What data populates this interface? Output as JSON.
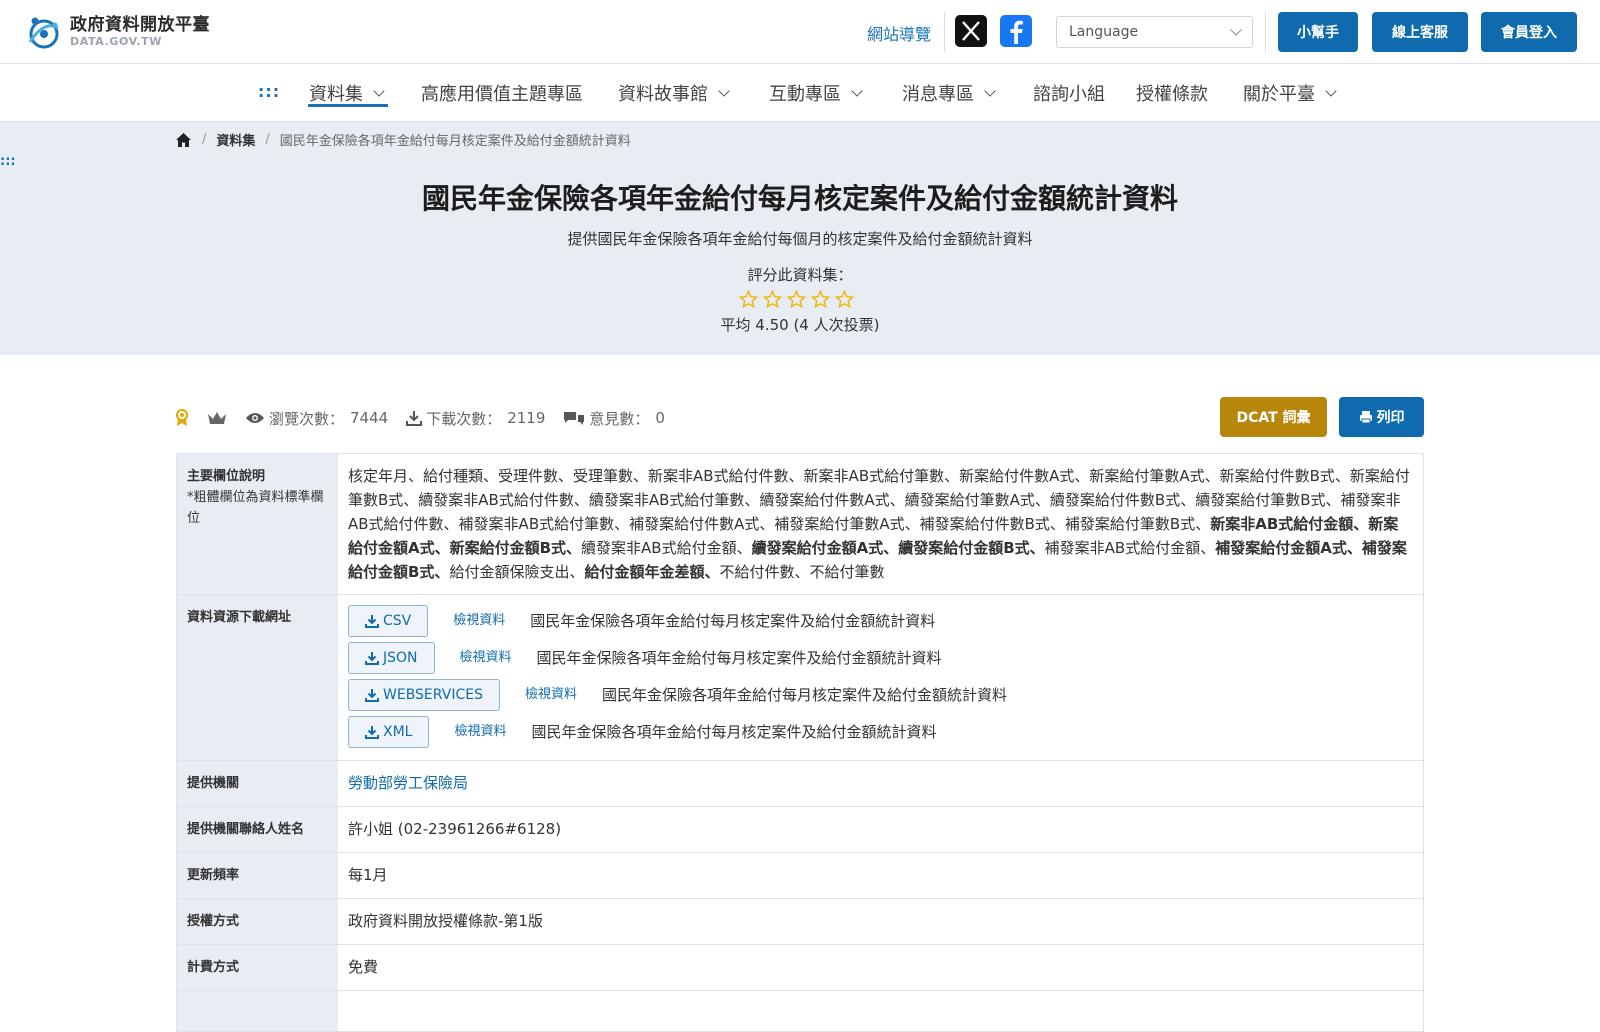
{
  "header": {
    "logo_zh": "政府資料開放平臺",
    "logo_en": "DATA.GOV.TW",
    "sitemap_link": "網站導覽",
    "language_placeholder": "Language",
    "helper_button": "小幫手",
    "support_button": "線上客服",
    "login_button": "會員登入"
  },
  "nav": {
    "accesskey": ":::",
    "items": [
      {
        "label": "資料集"
      },
      {
        "label": "高應用價值主題專區"
      },
      {
        "label": "資料故事館"
      },
      {
        "label": "互動專區"
      },
      {
        "label": "消息專區"
      },
      {
        "label": "諮詢小組"
      },
      {
        "label": "授權條款"
      },
      {
        "label": "關於平臺"
      }
    ]
  },
  "breadcrumb": {
    "items": [
      "資料集",
      "國民年金保險各項年金給付每月核定案件及給付金額統計資料"
    ],
    "separator": "/"
  },
  "hero": {
    "accesskey": ":::",
    "title": "國民年金保險各項年金給付每月核定案件及給付金額統計資料",
    "description": "提供國民年金保險各項年金給付每個月的核定案件及給付金額統計資料",
    "rating_label": "評分此資料集：",
    "average": "平均 4.50 (4 人次投票)",
    "star_color": "#f0b400"
  },
  "stats": {
    "views_label": "瀏覽次數：",
    "views": "7444",
    "downloads_label": "下載次數：",
    "downloads": "2119",
    "comments_label": "意見數：",
    "comments": "0",
    "dcat_button": "DCAT 詞彙",
    "print_button": "列印"
  },
  "table": {
    "fields_label": "主要欄位說明",
    "fields_note": "*粗體欄位為資料標準欄位",
    "fields": [
      {
        "t": "核定年月、給付種類、受理件數、受理筆數、新案非AB式給付件數、新案非AB式給付筆數、新案給付件數A式、新案給付筆數A式、新案給付件數B式、新案給付筆數B式、續發案非AB式給付件數、續發案非AB式給付筆數、續發案給付件數A式、續發案給付筆數A式、續發案給付件數B式、續發案給付筆數B式、補發案非AB式給付件數、補發案非AB式給付筆數、補發案給付件數A式、補發案給付筆數A式、補發案給付件數B式、補發案給付筆數B式、",
        "b": false
      },
      {
        "t": "新案非AB式給付金額、新案給付金額A式、新案給付金額B式、",
        "b": true
      },
      {
        "t": "續發案非AB式給付金額、",
        "b": false
      },
      {
        "t": "續發案給付金額A式、續發案給付金額B式、",
        "b": true
      },
      {
        "t": "補發案非AB式給付金額、",
        "b": false
      },
      {
        "t": "補發案給付金額A式、補發案給付金額B式、",
        "b": true
      },
      {
        "t": "給付金額保險支出、",
        "b": false
      },
      {
        "t": "給付金額年金差額、",
        "b": true
      },
      {
        "t": "不給付件數、不給付筆數",
        "b": false
      }
    ],
    "download_label": "資料資源下載網址",
    "downloads": [
      {
        "format": "CSV",
        "view": "檢視資料",
        "name": "國民年金保險各項年金給付每月核定案件及給付金額統計資料"
      },
      {
        "format": "JSON",
        "view": "檢視資料",
        "name": "國民年金保險各項年金給付每月核定案件及給付金額統計資料"
      },
      {
        "format": "WEBSERVICES",
        "view": "檢視資料",
        "name": "國民年金保險各項年金給付每月核定案件及給付金額統計資料"
      },
      {
        "format": "XML",
        "view": "檢視資料",
        "name": "國民年金保險各項年金給付每月核定案件及給付金額統計資料"
      }
    ],
    "provider_label": "提供機關",
    "provider": "勞動部勞工保險局",
    "contact_label": "提供機關聯絡人姓名",
    "contact": "許小姐 (02-23961266#6128)",
    "frequency_label": "更新頻率",
    "frequency": "每1月",
    "license_label": "授權方式",
    "license": "政府資料開放授權條款-第1版",
    "fee_label": "計費方式",
    "fee": "免費"
  }
}
